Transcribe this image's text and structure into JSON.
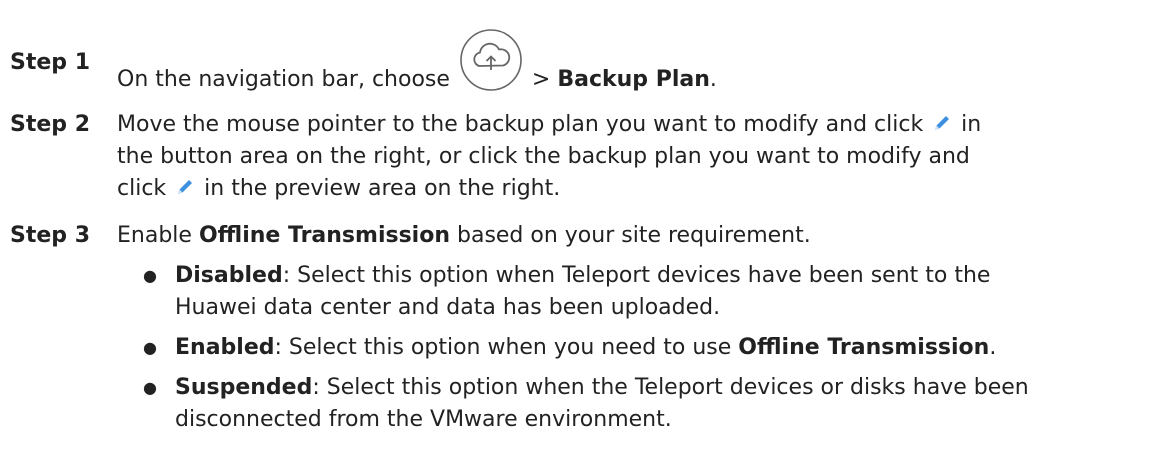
{
  "steps": [
    {
      "label": "Step 1",
      "text_before": "On the navigation bar, choose",
      "text_after_icon": " > ",
      "bold": "Backup Plan",
      "text_end": "."
    },
    {
      "label": "Step 2",
      "line1_a": "Move the mouse pointer to the backup plan you want to modify and click",
      "line1_b": " in",
      "line2": "the button area on the right, or click the backup plan you want to modify and",
      "line3_a": "click",
      "line3_b": " in the preview area on the right."
    },
    {
      "label": "Step 3",
      "line1_a": "Enable ",
      "line1_bold": "Offline Transmission",
      "line1_b": " based on your site requirement.",
      "bullets": [
        {
          "bold": "Disabled",
          "line1": ": Select this option when Teleport devices have been sent to the",
          "line2": "Huawei data center and data has been uploaded."
        },
        {
          "bold": "Enabled",
          "line1": ": Select this option when you need to use ",
          "bold2": "Offline Transmission",
          "line1_end": "."
        },
        {
          "bold": "Suspended",
          "line1": ": Select this option when the Teleport devices or disks have been",
          "line2": "disconnected from the VMware environment."
        }
      ]
    }
  ],
  "icons": {
    "cloud": "cloud-upload-icon",
    "pencil": "edit-pencil-icon",
    "pencil_color": "#3d8fe0"
  }
}
